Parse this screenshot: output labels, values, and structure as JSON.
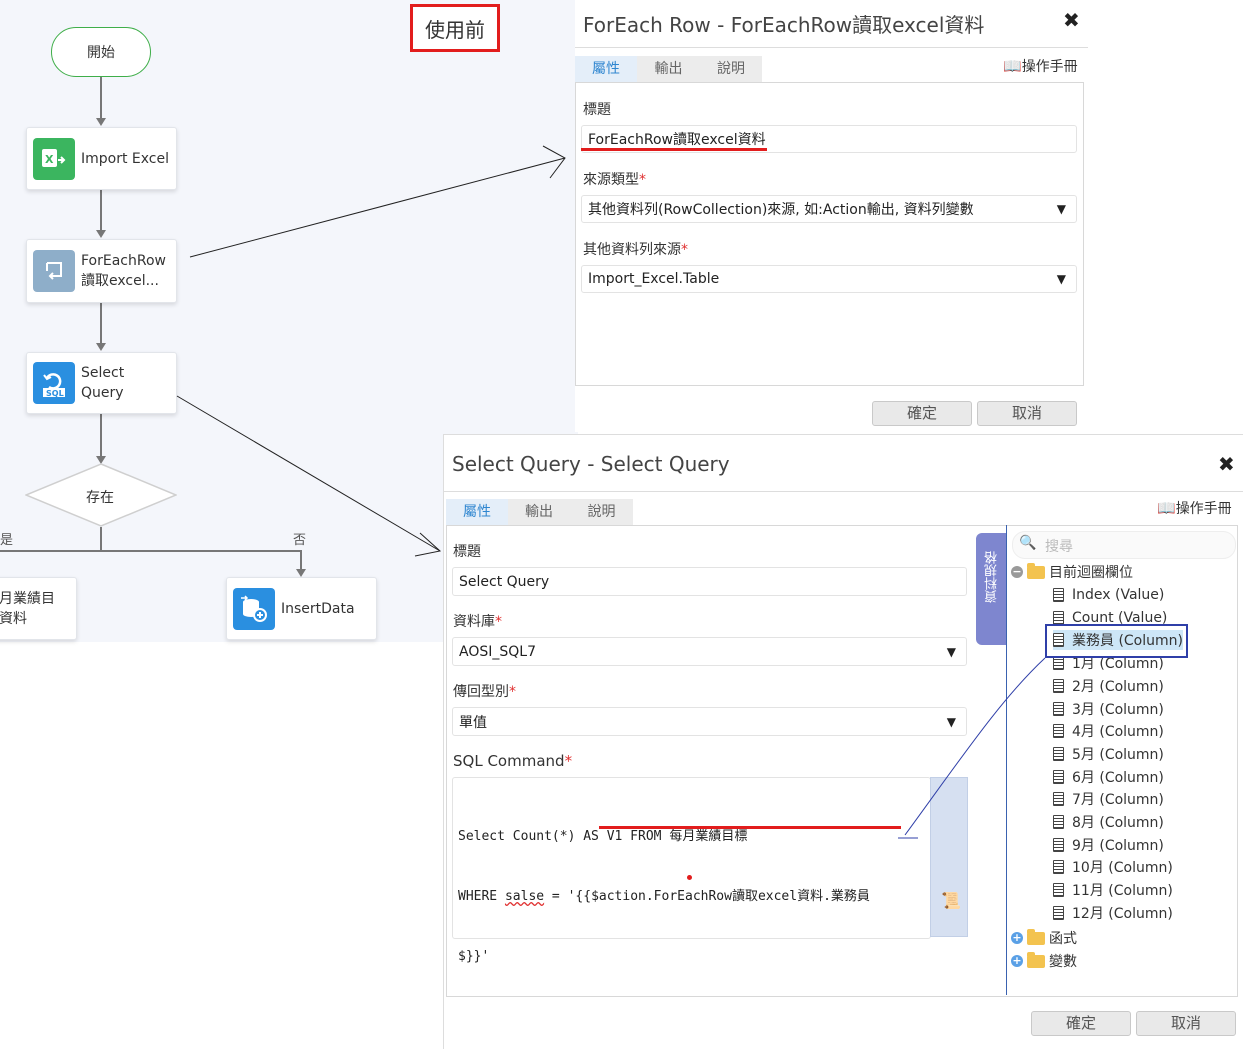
{
  "flow": {
    "nodes": {
      "start": "開始",
      "import_excel": "Import Excel",
      "foreach_row_line1": "ForEachRow",
      "foreach_row_line2": "讀取excel...",
      "select_query_line1": "Select",
      "select_query_line2": "Query",
      "exists": "存在",
      "left_branch": "是",
      "right_branch": "否",
      "left_node_line1": "月業績目",
      "left_node_line2": "資料",
      "insert_data": "InsertData"
    }
  },
  "annotation": {
    "label": "使用前"
  },
  "foreach_dialog": {
    "title": "ForEach Row - ForEachRow讀取excel資料",
    "tabs": [
      "屬性",
      "輸出",
      "說明"
    ],
    "manual": "操作手冊",
    "title_label": "標題",
    "title_value": "ForEachRow讀取excel資料",
    "source_type_label": "來源類型",
    "source_type_value": "其他資料列(RowCollection)來源, 如:Action輸出, 資料列變數",
    "other_source_label": "其他資料列來源",
    "other_source_value": "Import_Excel.Table",
    "ok": "確定",
    "cancel": "取消"
  },
  "select_dialog": {
    "title": "Select Query - Select Query",
    "tabs": [
      "屬性",
      "輸出",
      "說明"
    ],
    "manual": "操作手冊",
    "title_label": "標題",
    "title_value": "Select Query",
    "db_label": "資料庫",
    "db_value": "AOSI_SQL7",
    "return_label": "傳回型別",
    "return_value": "單值",
    "sql_label": "SQL Command",
    "sql_line1": "Select Count(*) AS V1 FROM 每月業績目標",
    "sql_line2a": "WHERE ",
    "sql_line2b": "salse",
    "sql_line2c": " = '{{$action.ForEachRow讀取excel資料.業務員",
    "sql_line3": "$}}'",
    "spec_tab": "資料規格",
    "search_placeholder": "搜尋",
    "tree": {
      "loop_folder": "目前迴圈欄位",
      "items": [
        "Index (Value)",
        "Count (Value)",
        "業務員 (Column)",
        "1月 (Column)",
        "2月 (Column)",
        "3月 (Column)",
        "4月 (Column)",
        "5月 (Column)",
        "6月 (Column)",
        "7月 (Column)",
        "8月 (Column)",
        "9月 (Column)",
        "10月 (Column)",
        "11月 (Column)",
        "12月 (Column)"
      ],
      "functions_folder": "函式",
      "variables_folder": "變數"
    },
    "ok": "確定",
    "cancel": "取消"
  }
}
